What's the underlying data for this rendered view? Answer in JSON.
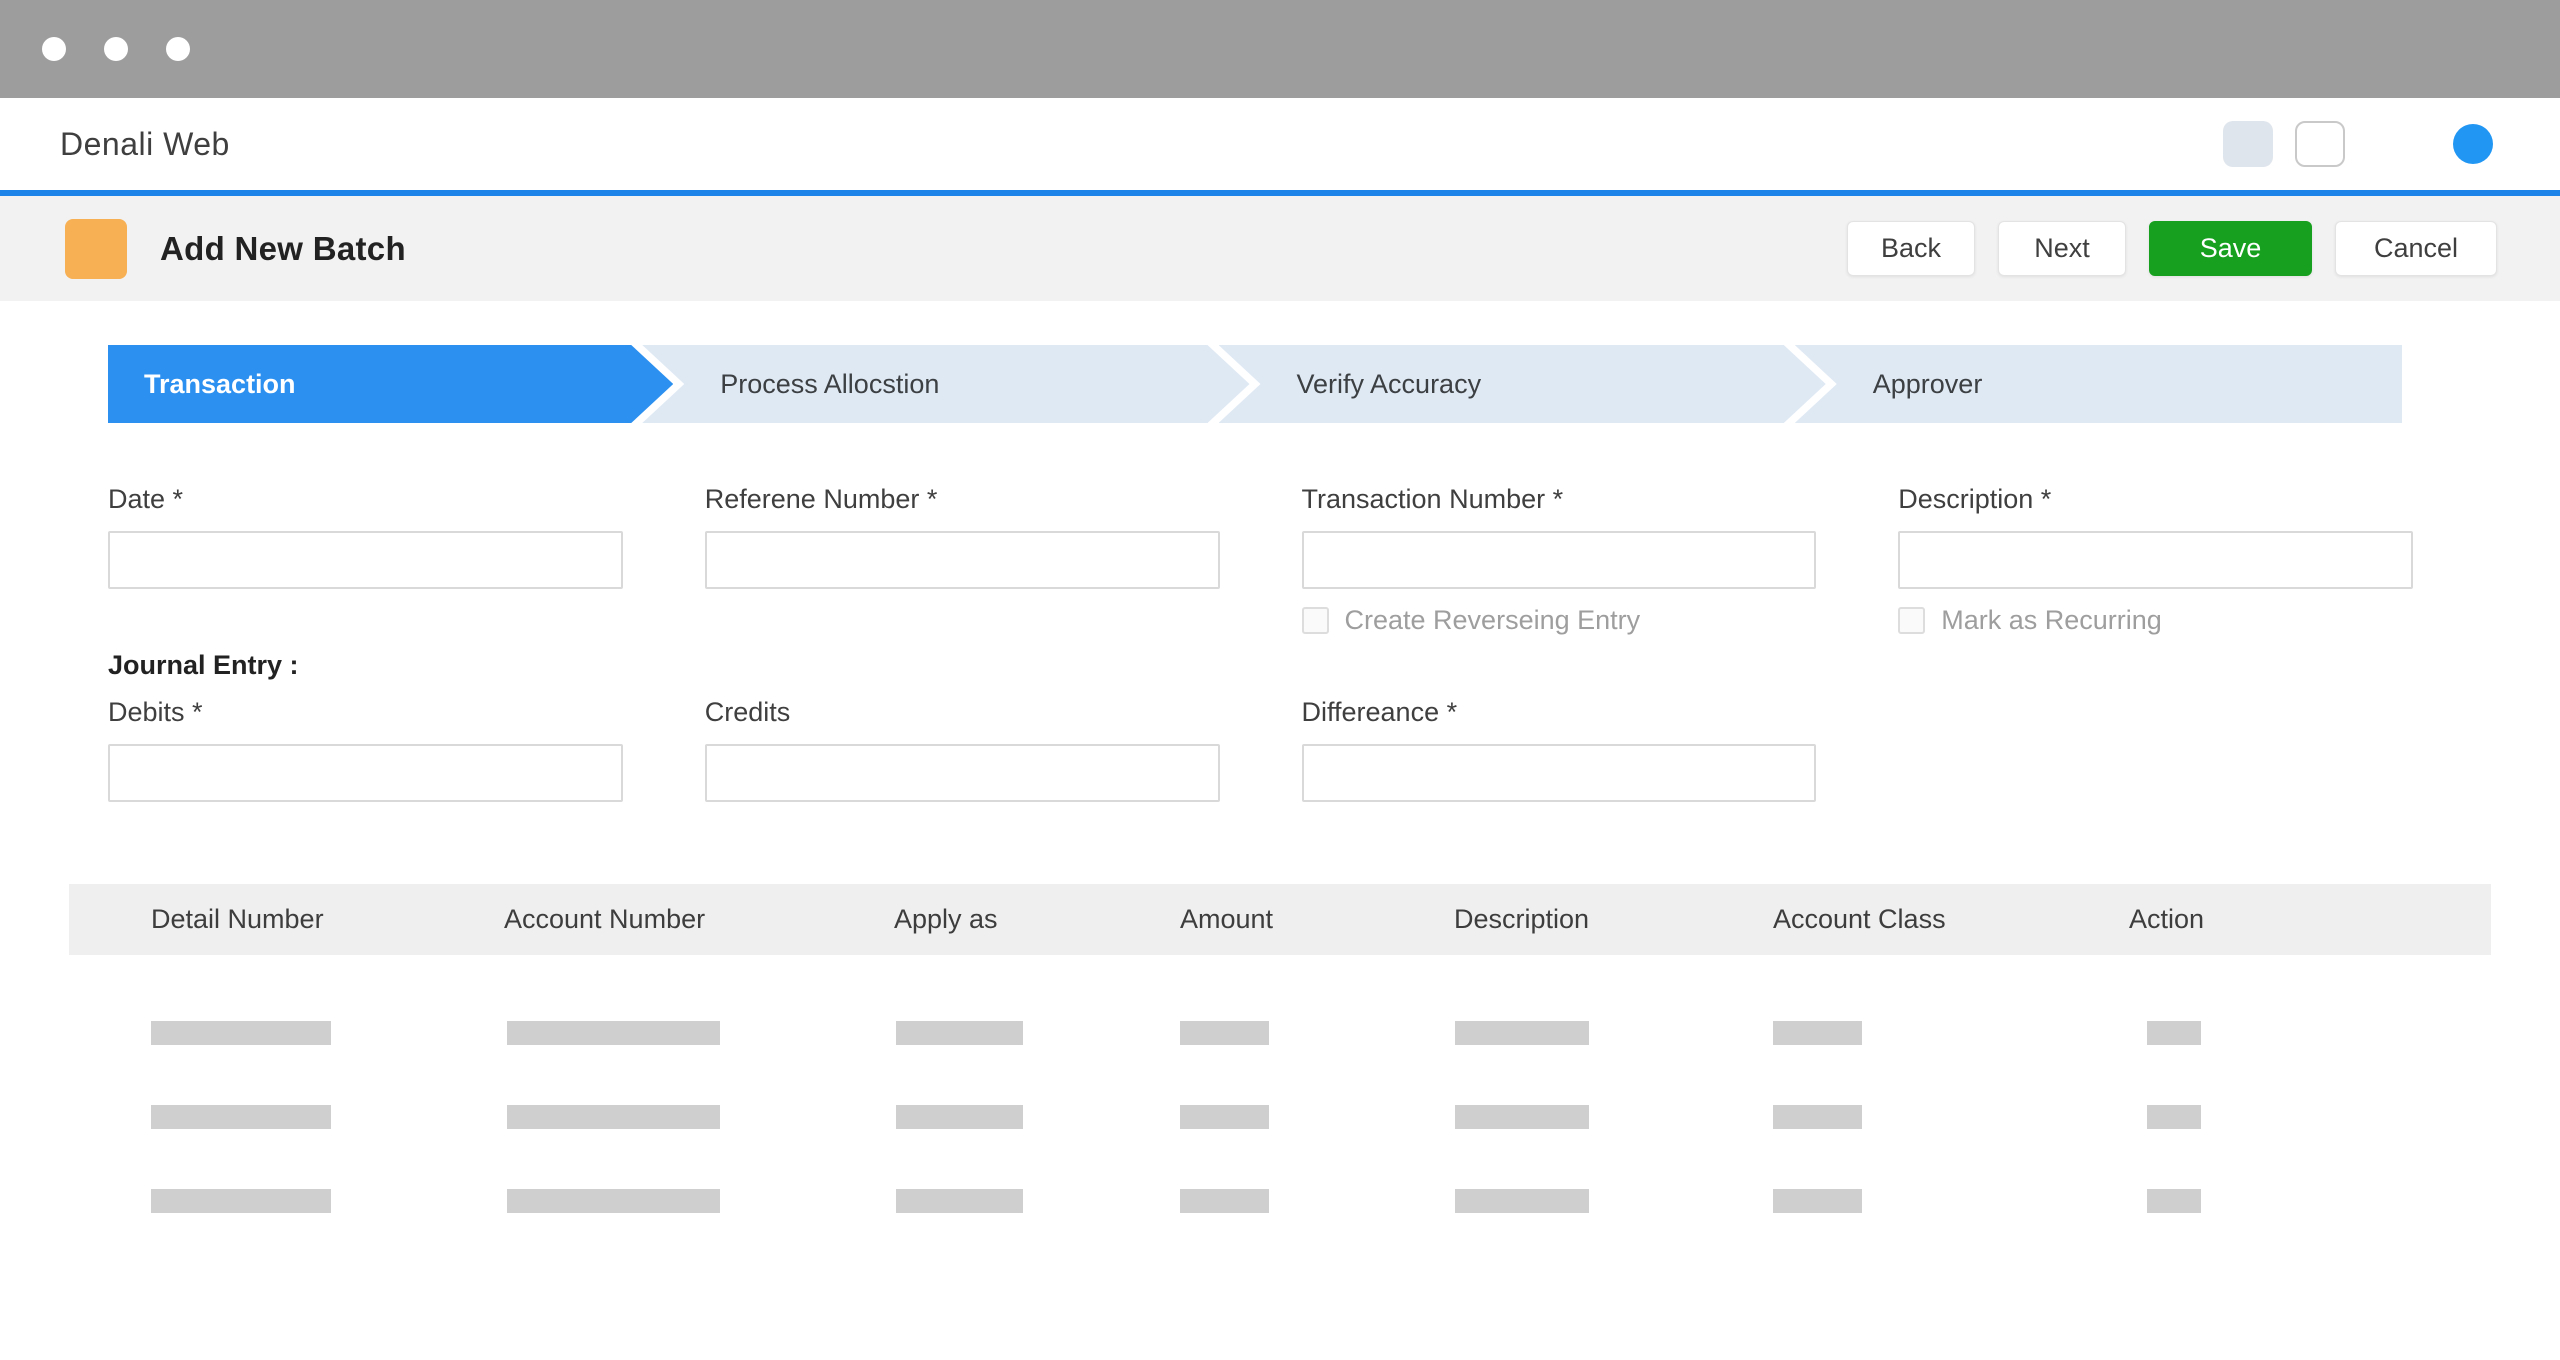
{
  "window": {
    "dots": 3
  },
  "appbar": {
    "title": "Denali Web",
    "icons": [
      "filled-square-icon",
      "outlined-square-icon",
      "avatar-circle"
    ]
  },
  "page_header": {
    "icon": "batch-icon",
    "title": "Add New Batch",
    "buttons": {
      "back": "Back",
      "next": "Next",
      "save": "Save",
      "cancel": "Cancel"
    }
  },
  "stepper": {
    "steps": [
      {
        "label": "Transaction",
        "active": true
      },
      {
        "label": "Process Allocstion",
        "active": false
      },
      {
        "label": "Verify Accuracy",
        "active": false
      },
      {
        "label": "Approver",
        "active": false
      }
    ]
  },
  "form": {
    "fields": {
      "date": {
        "label": "Date *",
        "value": ""
      },
      "reference_number": {
        "label": "Referene Number *",
        "value": ""
      },
      "transaction_number": {
        "label": "Transaction Number *",
        "value": "",
        "checkbox": "Create Reverseing Entry",
        "checked": false
      },
      "description": {
        "label": "Description *",
        "value": "",
        "checkbox": "Mark as Recurring",
        "checked": false
      },
      "journal_heading": "Journal Entry :",
      "debits": {
        "label": "Debits *",
        "value": ""
      },
      "credits": {
        "label": "Credits",
        "value": ""
      },
      "difference": {
        "label": "Differeance *",
        "value": ""
      }
    }
  },
  "table": {
    "columns": [
      "Detail Number",
      "Account Number",
      "Apply as",
      "Amount",
      "Description",
      "Account Class",
      "Action"
    ],
    "skeleton_rows": 3
  },
  "colors": {
    "titlebar-gray": "#9d9d9d",
    "accent-blue": "#1d84ea",
    "avatar-blue": "#2196f3",
    "step-active": "#2b90f0",
    "step-inactive": "#dfe9f4",
    "save-green": "#17a01f",
    "icon-orange": "#f7b054",
    "band-gray": "#f2f2f2",
    "table-header-gray": "#efefef",
    "skeleton-gray": "#cfcfcf"
  }
}
